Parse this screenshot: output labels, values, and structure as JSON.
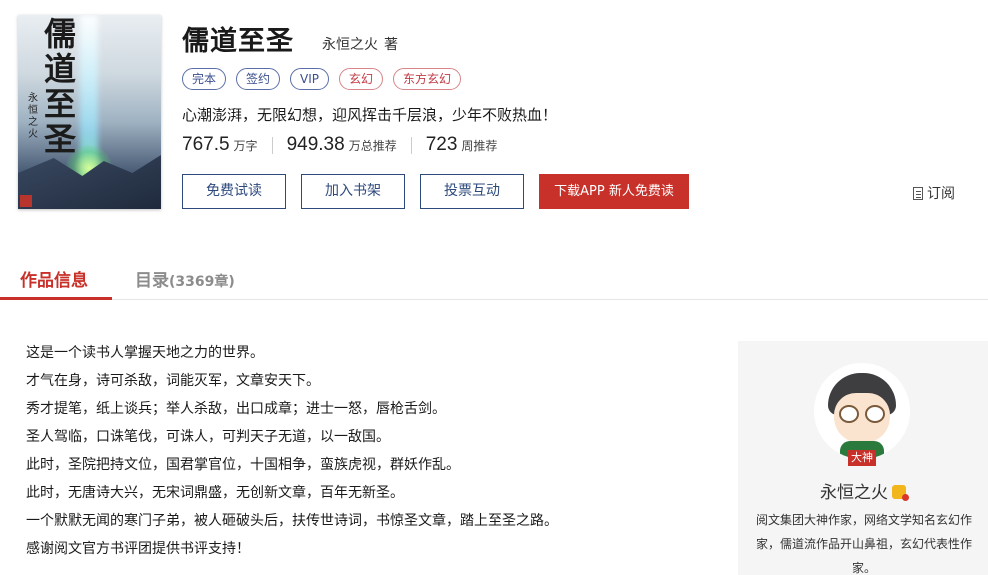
{
  "book": {
    "cover": {
      "title": "儒道至圣",
      "author": "永恒之火"
    },
    "title": "儒道至圣",
    "author": "永恒之火",
    "author_suffix": "著",
    "tags": [
      "完本",
      "签约",
      "VIP",
      "玄幻",
      "东方玄幻"
    ],
    "intro": "心潮澎湃，无限幻想，迎风挥击千层浪，少年不败热血！",
    "stats": [
      {
        "num": "767.5",
        "unit": "万字"
      },
      {
        "num": "949.38",
        "unit": "万总推荐"
      },
      {
        "num": "723",
        "unit": "周推荐"
      }
    ]
  },
  "actions": {
    "read": "免费试读",
    "shelf": "加入书架",
    "vote": "投票互动",
    "download": "下载APP 新人免费读",
    "subscribe": "订阅"
  },
  "tabs": {
    "info": "作品信息",
    "catalog": "目录",
    "catalog_count": "(3369章)"
  },
  "synopsis": [
    "这是一个读书人掌握天地之力的世界。",
    "才气在身，诗可杀敌，词能灭军，文章安天下。",
    "秀才提笔，纸上谈兵；举人杀敌，出口成章；进士一怒，唇枪舌剑。",
    "圣人驾临，口诛笔伐，可诛人，可判天子无道，以一敌国。",
    "此时，圣院把持文位，国君掌官位，十国相争，蛮族虎视，群妖作乱。",
    "此时，无唐诗大兴，无宋词鼎盛，无创新文章，百年无新圣。",
    "一个默默无闻的寒门子弟，被人砸破头后，扶传世诗词，书惊圣文章，踏上至圣之路。",
    "感谢阅文官方书评团提供书评支持！"
  ],
  "author_card": {
    "badge": "大神",
    "name": "永恒之火",
    "description": "阅文集团大神作家，网络文学知名玄幻作家，儒道流作品开山鼻祖，玄幻代表性作家。"
  },
  "colors": {
    "accent_red": "#c8312a",
    "button_blue": "#2e4a7d"
  }
}
